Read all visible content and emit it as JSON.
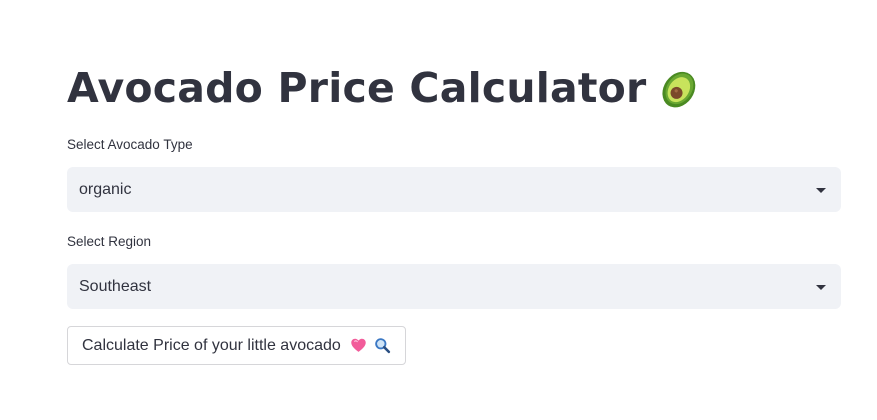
{
  "page": {
    "title": "Avocado Price Calculator",
    "title_icon": "avocado-icon"
  },
  "type_select": {
    "label": "Select Avocado Type",
    "value": "organic"
  },
  "region_select": {
    "label": "Select Region",
    "value": "Southeast"
  },
  "calculate_button": {
    "label": "Calculate Price of your little avocado",
    "icons": [
      "pink-heart-icon",
      "magnifying-glass-icon"
    ]
  },
  "colors": {
    "text": "#31333f",
    "select_background": "#f0f2f6",
    "button_border": "#d6d6d9",
    "avocado_skin": "#5c9c2c",
    "avocado_flesh": "#c2e05a",
    "avocado_pit": "#7a4a2a",
    "heart": "#f25c9a",
    "magnifier": "#3b78c4"
  }
}
